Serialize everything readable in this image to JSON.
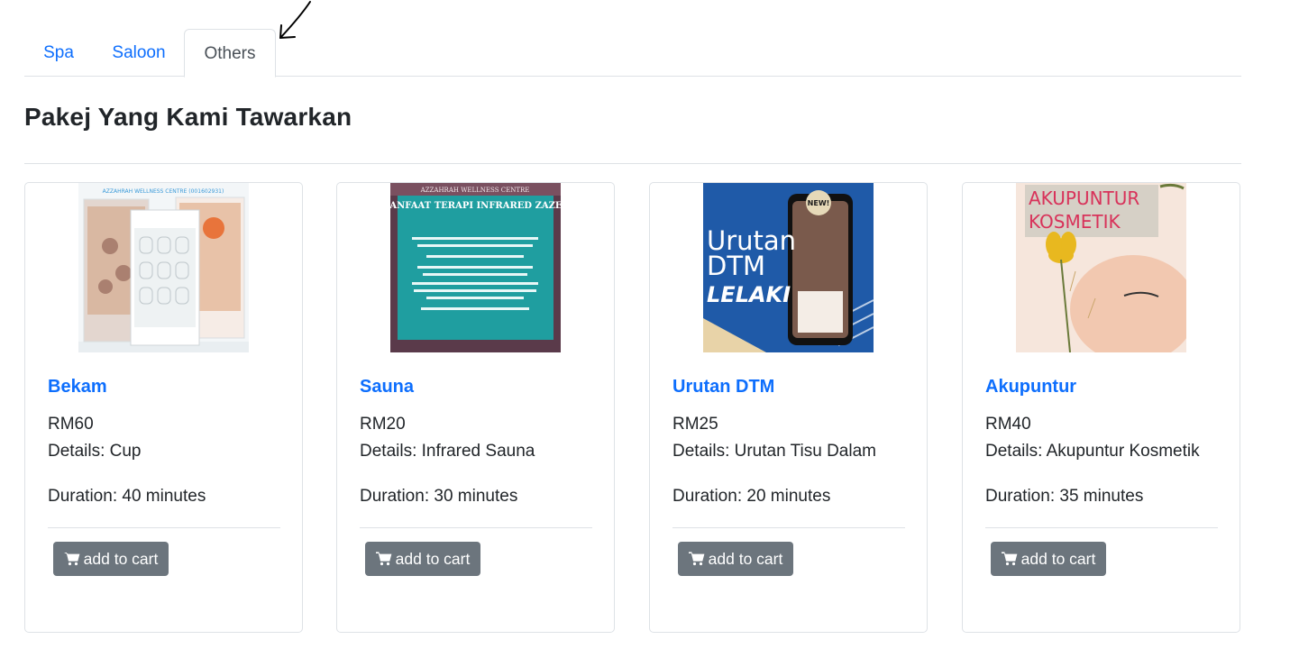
{
  "tabs": [
    {
      "label": "Spa"
    },
    {
      "label": "Saloon"
    },
    {
      "label": "Others"
    }
  ],
  "heading": "Pakej Yang Kami Tawarkan",
  "cards": [
    {
      "name": "Bekam",
      "price": "RM60",
      "details": "Details: Cup",
      "duration": "Duration: 40 minutes",
      "button": "add to cart",
      "image_text": "AZZAHRAH WELLNESS CENTRE (001602931)"
    },
    {
      "name": "Sauna",
      "price": "RM20",
      "details": "Details: Infrared Sauna",
      "duration": "Duration: 30 minutes",
      "button": "add to cart",
      "image_text": "AZZAHRAH WELLNESS CENTRE",
      "image_title": "MANFAAT TERAPI INFRARED ZAZEN"
    },
    {
      "name": "Urutan DTM",
      "price": "RM25",
      "details": "Details: Urutan Tisu Dalam",
      "duration": "Duration: 20 minutes",
      "button": "add to cart",
      "image_title_1": "Urutan",
      "image_title_2": "DTM",
      "image_title_3": "LELAKI",
      "image_badge": "NEW!"
    },
    {
      "name": "Akupuntur",
      "price": "RM40",
      "details": "Details: Akupuntur Kosmetik",
      "duration": "Duration: 35 minutes",
      "button": "add to cart",
      "image_title_1": "AKUPUNTUR",
      "image_title_2": "KOSMETIK"
    }
  ],
  "icons": {
    "cart": "shopping-cart-icon",
    "arrow": "arrow-annotation-icon"
  },
  "colors": {
    "link": "#0d6efd",
    "button": "#6c757d",
    "border": "#dee2e6"
  }
}
